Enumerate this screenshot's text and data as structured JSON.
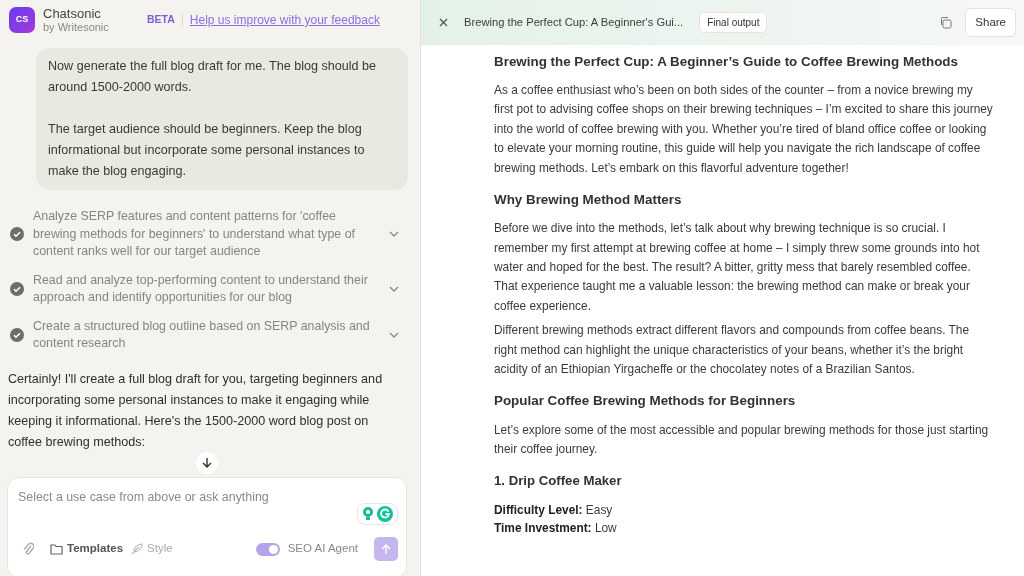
{
  "app": {
    "logo": "CS",
    "name": "Chatsonic",
    "byline": "by Writesonic",
    "badge": "BETA",
    "feedback_link": "Help us improve with your feedback"
  },
  "user_message": [
    "Now generate the full blog draft for me. The blog should be around 1500-2000 words.",
    "The target audience should be beginners. Keep the blog informational but incorporate some personal instances to make the blog engaging."
  ],
  "steps": [
    {
      "text": "Analyze SERP features and content patterns for 'coffee brewing methods for beginners' to understand what type of content ranks well for our target audience",
      "done": true
    },
    {
      "text": "Read and analyze top-performing content to understand their approach and identify opportunities for our blog",
      "done": true
    },
    {
      "text": "Create a structured blog outline based on SERP analysis and content research",
      "done": true
    }
  ],
  "assistant_message": "Certainly! I'll create a full blog draft for you, targeting beginners and incorporating some personal instances to make it engaging while keeping it informational. Here's the 1500-2000 word blog post on coffee brewing methods:",
  "composer": {
    "placeholder": "Select a use case from above or ask anything",
    "templates": "Templates",
    "style": "Style",
    "agent_label": "SEO AI Agent",
    "agent_on": true
  },
  "document": {
    "title": "Brewing the Perfect Cup: A Beginner's Gui...",
    "status": "Final output",
    "share": "Share"
  },
  "article": [
    {
      "kind": "h1",
      "text": "Brewing the Perfect Cup: A Beginner’s Guide to Coffee Brewing Methods"
    },
    {
      "kind": "p",
      "text": "As a coffee enthusiast who’s been on both sides of the counter – from a novice brewing my first pot to advising coffee shops on their brewing techniques – I’m excited to share this journey into the world of coffee brewing with you. Whether you’re tired of bland office coffee or looking to elevate your morning routine, this guide will help you navigate the rich landscape of coffee brewing methods. Let’s embark on this flavorful adventure together!"
    },
    {
      "kind": "h2",
      "text": "Why Brewing Method Matters"
    },
    {
      "kind": "p",
      "text": "Before we dive into the methods, let’s talk about why brewing technique is so crucial. I remember my first attempt at brewing coffee at home – I simply threw some grounds into hot water and hoped for the best. The result? A bitter, gritty mess that barely resembled coffee. That experience taught me a valuable lesson: the brewing method can make or break your coffee experience."
    },
    {
      "kind": "p",
      "text": "Different brewing methods extract different flavors and compounds from coffee beans. The right method can highlight the unique characteristics of your beans, whether it’s the bright acidity of an Ethiopian Yirgacheffe or the chocolatey notes of a Brazilian Santos."
    },
    {
      "kind": "h2",
      "text": "Popular Coffee Brewing Methods for Beginners"
    },
    {
      "kind": "p",
      "text": "Let’s explore some of the most accessible and popular brewing methods for those just starting their coffee journey."
    },
    {
      "kind": "h3",
      "text": "1. Drip Coffee Maker"
    },
    {
      "kind": "field",
      "text": "**Difficulty Level:** Easy"
    },
    {
      "kind": "field",
      "text": "**Time Investment:** Low"
    }
  ]
}
